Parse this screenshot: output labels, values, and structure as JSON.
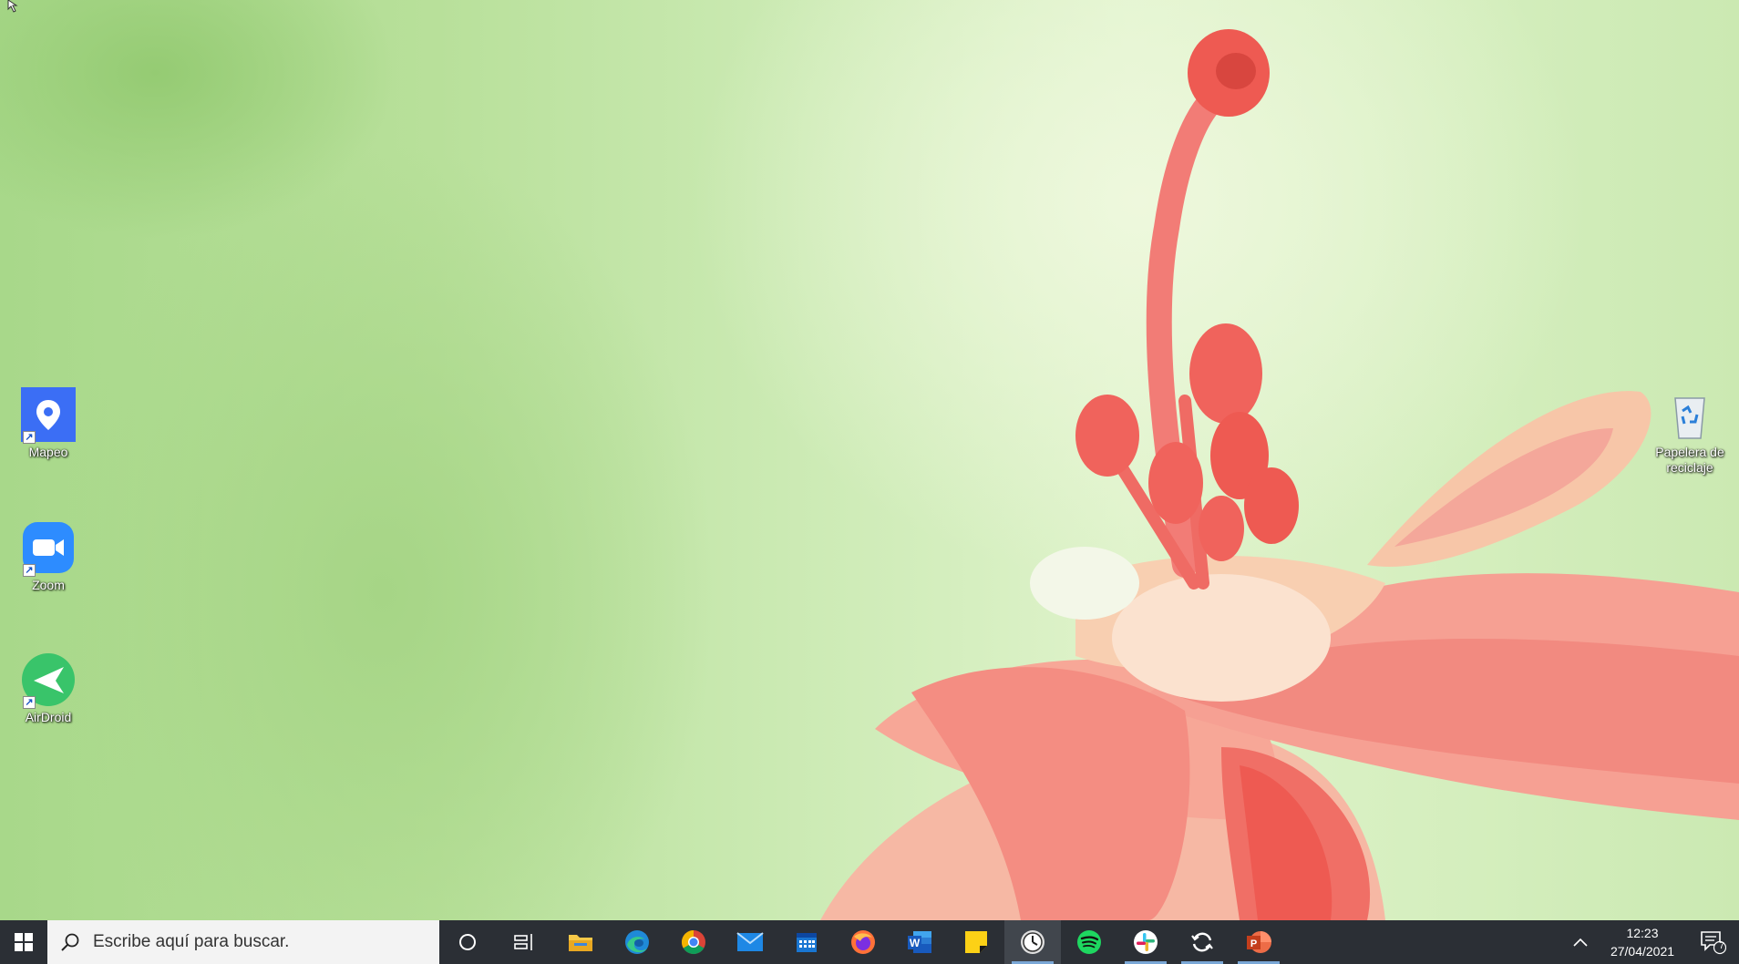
{
  "desktop": {
    "icons": [
      {
        "label": "Mapeo",
        "icon": "map-pin-icon",
        "color": "#3b6ef5"
      },
      {
        "label": "Zoom",
        "icon": "video-camera-icon",
        "color": "#2d8cff"
      },
      {
        "label": "AirDroid",
        "icon": "paper-plane-icon",
        "color": "#39c46a"
      },
      {
        "label": "Papelera de reciclaje",
        "icon": "recycle-bin-icon"
      }
    ]
  },
  "taskbar": {
    "search_placeholder": "Escribe aquí para buscar.",
    "pinned": [
      {
        "name": "cortana",
        "icon": "cortana-circle-icon"
      },
      {
        "name": "task-view",
        "icon": "task-view-icon"
      },
      {
        "name": "file-explorer",
        "icon": "folder-icon"
      },
      {
        "name": "edge",
        "icon": "edge-icon"
      },
      {
        "name": "chrome",
        "icon": "chrome-icon"
      },
      {
        "name": "mail",
        "icon": "mail-icon"
      },
      {
        "name": "calendar",
        "icon": "calendar-icon"
      },
      {
        "name": "firefox",
        "icon": "firefox-icon"
      },
      {
        "name": "word",
        "icon": "word-icon"
      },
      {
        "name": "sticky-notes",
        "icon": "sticky-notes-icon"
      },
      {
        "name": "clock-app",
        "icon": "clock-icon"
      },
      {
        "name": "spotify",
        "icon": "spotify-icon"
      },
      {
        "name": "slack",
        "icon": "slack-icon"
      },
      {
        "name": "sync",
        "icon": "sync-icon"
      },
      {
        "name": "powerpoint",
        "icon": "powerpoint-icon"
      }
    ],
    "clock": {
      "time": "12:23",
      "date": "27/04/2021"
    },
    "notifications_count": "7"
  },
  "colors": {
    "taskbar": "#2b2f35",
    "accent": "#7aa7d6"
  }
}
